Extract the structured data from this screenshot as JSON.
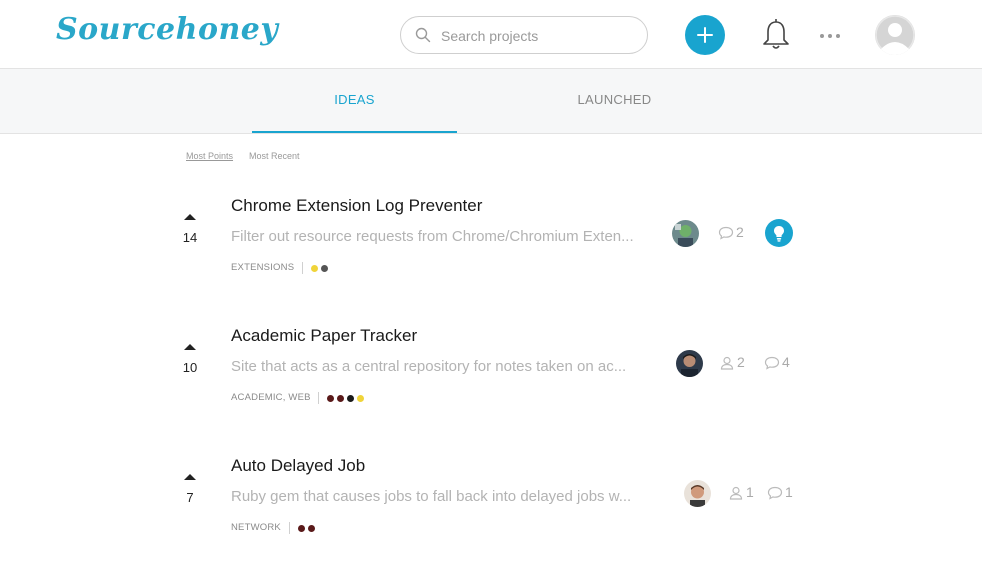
{
  "header": {
    "logo": "Sourcehoney",
    "search_placeholder": "Search projects",
    "add_icon": "plus-icon",
    "notification_icon": "bell-icon",
    "more_icon": "ellipsis-icon",
    "avatar_icon": "user-silhouette-icon"
  },
  "tabs": [
    {
      "label": "IDEAS",
      "active": true
    },
    {
      "label": "LAUNCHED",
      "active": false
    }
  ],
  "sort": {
    "options": [
      "Most Points",
      "Most Recent"
    ],
    "active": "Most Points"
  },
  "colors": {
    "accent": "#19a4cf",
    "tag_yellow": "#f0d43a",
    "tag_gray": "#555555",
    "tag_maroon": "#5a1a1a",
    "tag_black": "#1a1a1a"
  },
  "projects": [
    {
      "votes": "14",
      "title": "Chrome Extension Log Preventer",
      "description": "Filter out resource requests from Chrome/Chromium Exten...",
      "tags": "EXTENSIONS",
      "dots": [
        "#f0d43a",
        "#555555"
      ],
      "members": null,
      "comments": "2",
      "badge_icon": "lightbulb-icon"
    },
    {
      "votes": "10",
      "title": "Academic Paper Tracker",
      "description": "Site that acts as a central repository for notes taken on ac...",
      "tags": "ACADEMIC, WEB",
      "dots": [
        "#5a1a1a",
        "#5a1a1a",
        "#1a1a1a",
        "#f0d43a"
      ],
      "members": "2",
      "comments": "4",
      "badge_icon": null
    },
    {
      "votes": "7",
      "title": "Auto Delayed Job",
      "description": "Ruby gem that causes jobs to fall back into delayed jobs w...",
      "tags": "NETWORK",
      "dots": [
        "#5a1a1a",
        "#5a1a1a"
      ],
      "members": "1",
      "comments": "1",
      "badge_icon": null
    }
  ]
}
